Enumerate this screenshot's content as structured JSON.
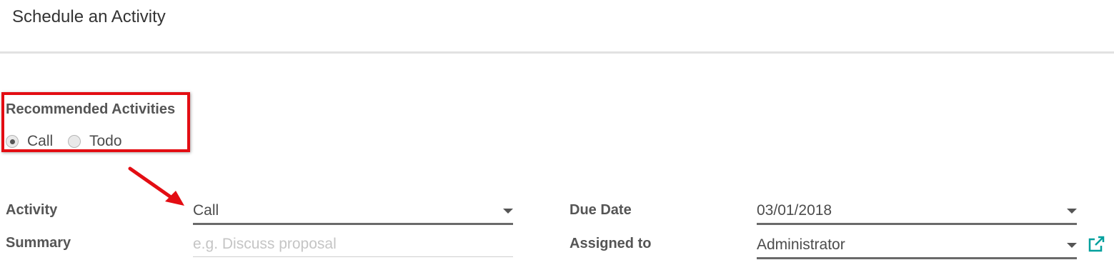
{
  "dialog": {
    "title": "Schedule an Activity"
  },
  "recommended": {
    "title": "Recommended Activities",
    "options": [
      {
        "label": "Call",
        "checked": true
      },
      {
        "label": "Todo",
        "checked": false
      }
    ]
  },
  "form": {
    "activity": {
      "label": "Activity",
      "value": "Call"
    },
    "summary": {
      "label": "Summary",
      "placeholder": "e.g. Discuss proposal"
    },
    "due_date": {
      "label": "Due Date",
      "value": "03/01/2018"
    },
    "assigned_to": {
      "label": "Assigned to",
      "value": "Administrator"
    }
  },
  "colors": {
    "highlight": "#e30d13",
    "link_icon": "#00a09d"
  },
  "icons": {
    "dropdown": "caret-down-icon",
    "external": "external-link-icon",
    "annotation": "arrow-icon"
  }
}
